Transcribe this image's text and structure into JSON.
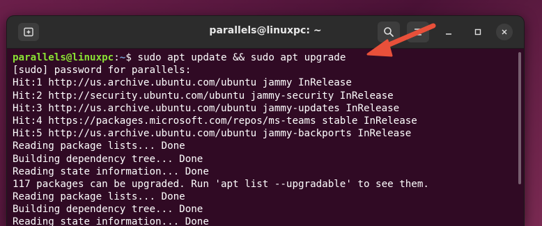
{
  "window": {
    "title": "parallels@linuxpc: ~"
  },
  "icons": {
    "new_tab": "new-tab-icon",
    "search": "search-icon",
    "menu": "hamburger-menu-icon",
    "minimize": "minimize-icon",
    "maximize": "maximize-icon",
    "close": "close-icon",
    "annotation": "red-arrow-icon"
  },
  "colors": {
    "terminal_bg": "#300a24",
    "titlebar_bg": "#2c2c2c",
    "prompt_user": "#8ae234",
    "prompt_path": "#729fcf",
    "arrow": "#e8503a"
  },
  "terminal": {
    "prompt": {
      "user_host": "parallels@linuxpc",
      "separator": ":",
      "path": "~",
      "symbol": "$ ",
      "command": "sudo apt update && sudo apt upgrade"
    },
    "output": [
      "[sudo] password for parallels:",
      "Hit:1 http://us.archive.ubuntu.com/ubuntu jammy InRelease",
      "Hit:2 http://security.ubuntu.com/ubuntu jammy-security InRelease",
      "Hit:3 http://us.archive.ubuntu.com/ubuntu jammy-updates InRelease",
      "Hit:4 https://packages.microsoft.com/repos/ms-teams stable InRelease",
      "Hit:5 http://us.archive.ubuntu.com/ubuntu jammy-backports InRelease",
      "Reading package lists... Done",
      "Building dependency tree... Done",
      "Reading state information... Done",
      "117 packages can be upgraded. Run 'apt list --upgradable' to see them.",
      "Reading package lists... Done",
      "Building dependency tree... Done",
      "Reading state information... Done"
    ]
  }
}
